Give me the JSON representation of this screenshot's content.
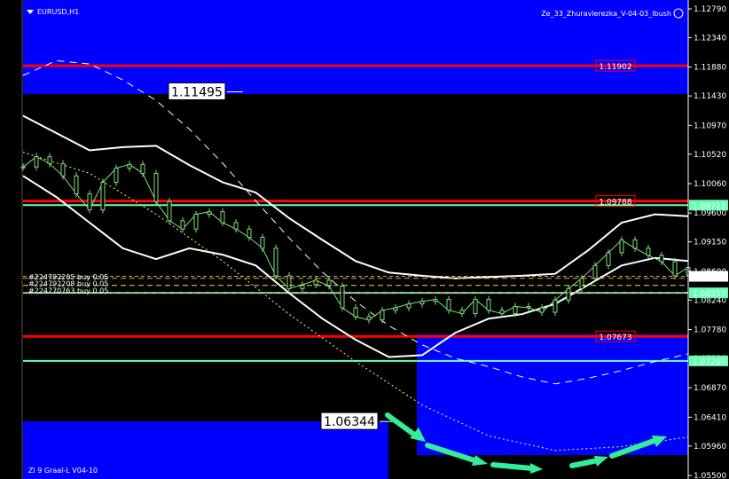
{
  "window": {
    "symbol_label": "EURUSD,H1",
    "indicator_title": "Ze_33_Zhuravlerezka_V-04-03_Ibush",
    "footer_label": "Zi 9 Graal-L  V04-10"
  },
  "colors": {
    "background": "#000000",
    "zone_blue": "#0000ff",
    "level_red": "#ff0000",
    "level_green": "#66ffb3",
    "candle_green": "#7fe07f",
    "band_white": "#ffffff",
    "ma_yellow": "#ffff66",
    "arrow_green": "#33ee99"
  },
  "chart_data": {
    "type": "line",
    "symbol": "EURUSD",
    "timeframe": "H1",
    "ylim": [
      1.055,
      1.1279
    ],
    "y_ticks": [
      1.1279,
      1.1234,
      1.1188,
      1.1143,
      1.1097,
      1.1052,
      1.1006,
      1.096,
      1.0915,
      1.0869,
      1.0824,
      1.0778,
      1.0733,
      1.0687,
      1.0641,
      1.0596,
      1.055
    ],
    "y_tick_labels": [
      "1.12790",
      "1.12340",
      "1.11880",
      "1.11430",
      "1.10970",
      "1.10520",
      "1.10060",
      "1.09600",
      "1.09150",
      "1.08690",
      "1.08240",
      "1.07780",
      "1.07330",
      "1.06870",
      "1.06410",
      "1.05960",
      "1.05500"
    ],
    "horizontal_levels": [
      {
        "label": "1.11902",
        "value": 1.11902,
        "color": "#ff0000",
        "style": "red-tag"
      },
      {
        "label": "1.09788",
        "value": 1.09788,
        "color": "#ff0000",
        "style": "red-tag"
      },
      {
        "label": "1.07673",
        "value": 1.07673,
        "color": "#ff0000",
        "style": "red-tag"
      },
      {
        "label": "1.09723",
        "value": 1.09723,
        "color": "#66ffb3",
        "style": "green-tag"
      },
      {
        "label": "1.07290",
        "value": 1.0729,
        "color": "#66ffb3",
        "style": "green-tag"
      },
      {
        "label": "1.08353",
        "value": 1.08353,
        "color": "#66ffb3",
        "style": "green-tag"
      },
      {
        "label": "1.08611",
        "value": 1.08611,
        "color": "#ffffff",
        "style": "white-tag"
      }
    ],
    "value_boxes": [
      {
        "label": "1.11495",
        "value": 1.11495
      },
      {
        "label": "1.06344",
        "value": 1.06344
      }
    ],
    "orders": [
      {
        "label": "#224792205 buy 0.05",
        "value": 1.0858
      },
      {
        "label": "#224792208 buy 0.05",
        "value": 1.0847
      },
      {
        "label": "#224770763 buy 0.05",
        "value": 1.0836
      }
    ],
    "series": [
      {
        "role": "price",
        "x": [
          0,
          2,
          4,
          6,
          8,
          10,
          12,
          14,
          16,
          18,
          20,
          22,
          24,
          26,
          28,
          30,
          32,
          34,
          36,
          38,
          40,
          42,
          44,
          46,
          48,
          50,
          52,
          54,
          56,
          58,
          60,
          62,
          64,
          66,
          68,
          70,
          72,
          74,
          76,
          78,
          80,
          82,
          84,
          86,
          88,
          90,
          92,
          94,
          96,
          98,
          100
        ],
        "y": [
          1.1032,
          1.1048,
          1.1037,
          1.1018,
          1.099,
          1.0965,
          1.1008,
          1.103,
          1.1036,
          1.1022,
          1.0978,
          1.0948,
          1.0935,
          1.0958,
          1.0962,
          1.0945,
          1.0935,
          1.0922,
          1.0905,
          1.0862,
          1.0842,
          1.0848,
          1.0855,
          1.0846,
          1.0812,
          1.0798,
          1.0793,
          1.0808,
          1.0812,
          1.0818,
          1.0822,
          1.0825,
          1.0808,
          1.0803,
          1.0825,
          1.0808,
          1.0803,
          1.0814,
          1.0812,
          1.0805,
          1.0824,
          1.0842,
          1.0858,
          1.0878,
          1.0898,
          1.0918,
          1.0905,
          1.0894,
          1.0884,
          1.0862,
          1.0875
        ]
      },
      {
        "role": "band-upper",
        "x": [
          0,
          5,
          10,
          15,
          20,
          25,
          30,
          35,
          40,
          45,
          50,
          55,
          60,
          65,
          70,
          75,
          80,
          85,
          90,
          95,
          100
        ],
        "y": [
          1.1112,
          1.1085,
          1.1058,
          1.1063,
          1.1065,
          1.1035,
          1.1008,
          1.0992,
          1.0952,
          1.0918,
          1.0885,
          1.0867,
          1.0862,
          1.0858,
          1.086,
          1.0862,
          1.0865,
          1.0902,
          1.0945,
          1.0958,
          1.0955
        ]
      },
      {
        "role": "band-lower",
        "x": [
          0,
          5,
          10,
          15,
          20,
          25,
          30,
          35,
          40,
          45,
          50,
          55,
          60,
          65,
          70,
          75,
          80,
          85,
          90,
          95,
          100
        ],
        "y": [
          1.1018,
          1.0985,
          1.0945,
          1.0905,
          1.0888,
          1.0905,
          1.0895,
          1.0878,
          1.0835,
          1.0795,
          1.0762,
          1.0735,
          1.0738,
          1.0773,
          1.0795,
          1.0802,
          1.0818,
          1.0848,
          1.0878,
          1.089,
          1.0885
        ]
      },
      {
        "role": "long-ma",
        "x": [
          0,
          10,
          20,
          30,
          40,
          50,
          60,
          70,
          80,
          90,
          100
        ],
        "y": [
          1.1055,
          1.1022,
          1.0958,
          1.0885,
          1.0802,
          1.0728,
          1.066,
          1.0612,
          1.0589,
          1.0595,
          1.061
        ]
      },
      {
        "role": "curve-dashed",
        "x": [
          0,
          5,
          10,
          15,
          20,
          25,
          30,
          35,
          40,
          45,
          50,
          55,
          60,
          65,
          70,
          75,
          80,
          85,
          90,
          95,
          100
        ],
        "y": [
          1.1175,
          1.1198,
          1.1193,
          1.1168,
          1.1136,
          1.1091,
          1.1038,
          1.0979,
          1.0921,
          1.0868,
          1.0822,
          1.0784,
          1.0754,
          1.0733,
          1.072,
          1.0704,
          1.0693,
          1.0702,
          1.0714,
          1.0728,
          1.074
        ]
      }
    ],
    "grid": false,
    "legend": "none"
  }
}
